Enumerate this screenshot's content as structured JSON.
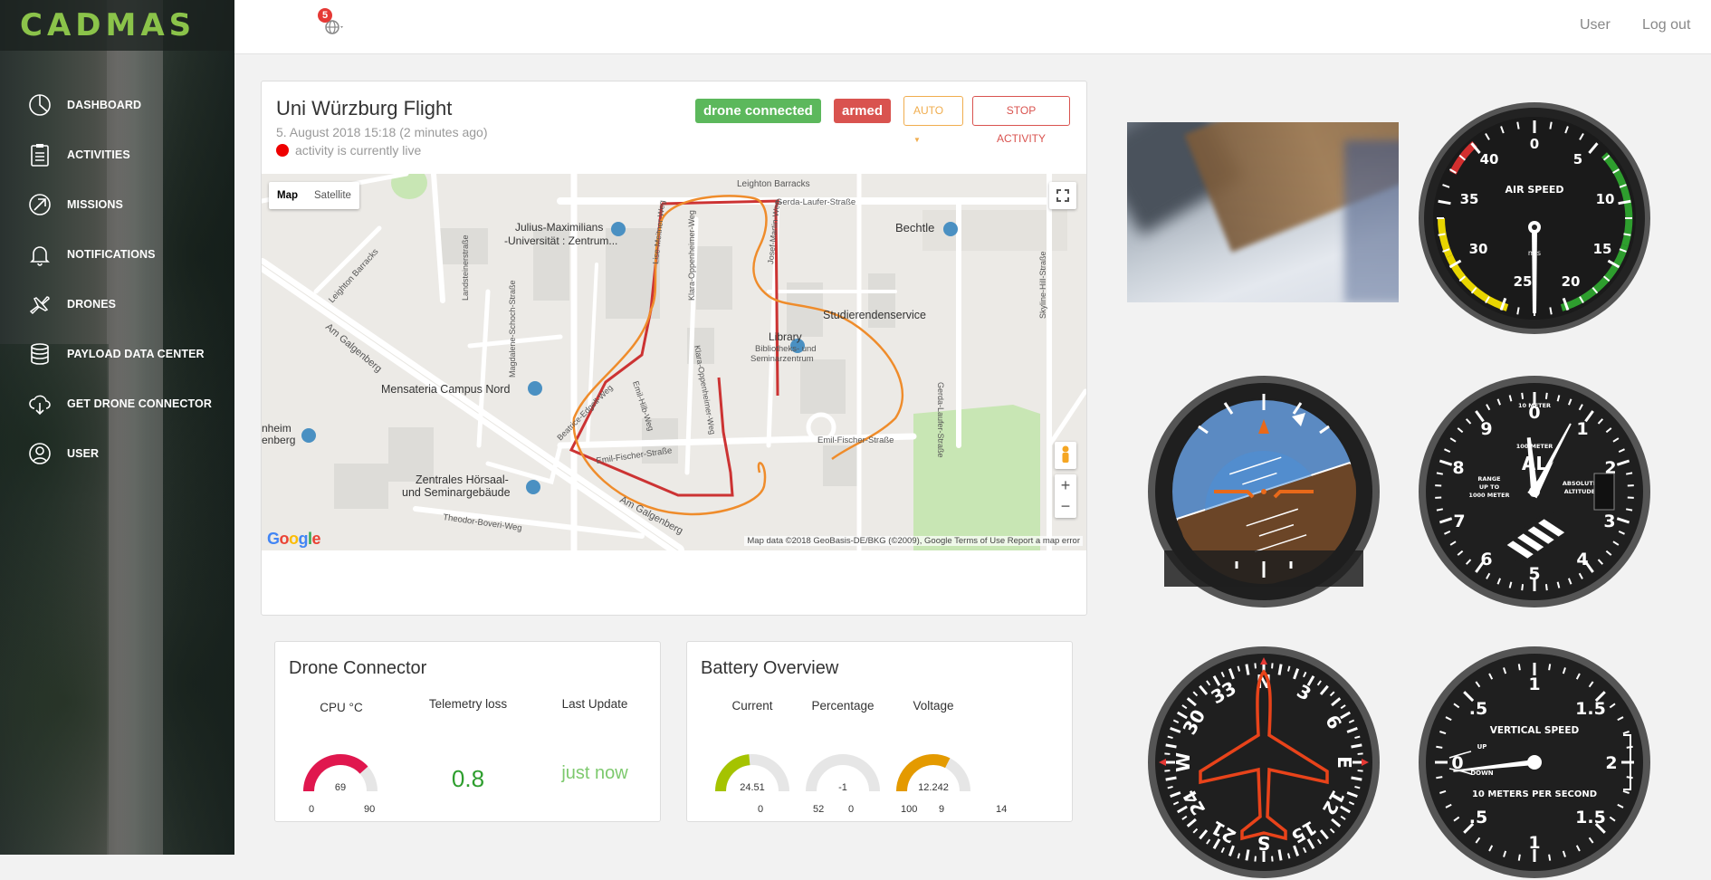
{
  "app": {
    "name": "CADMAS"
  },
  "sidebar": {
    "items": [
      {
        "label": "DASHBOARD"
      },
      {
        "label": "ACTIVITIES"
      },
      {
        "label": "MISSIONS"
      },
      {
        "label": "NOTIFICATIONS"
      },
      {
        "label": "DRONES"
      },
      {
        "label": "PAYLOAD DATA CENTER"
      },
      {
        "label": "GET DRONE CONNECTOR"
      },
      {
        "label": "USER"
      }
    ]
  },
  "topbar": {
    "notification_count": "5",
    "user_label": "User",
    "logout_label": "Log out"
  },
  "flight": {
    "title": "Uni Würzburg Flight",
    "date": "5. August 2018 15:18 (2 minutes ago)",
    "live_text": "activity is currently live",
    "status_connected": "drone connected",
    "status_armed": "armed",
    "mode_label": "AUTO",
    "stop_label": "STOP ACTIVITY",
    "colors": {
      "connected": "#5cb85c",
      "armed": "#d9534f",
      "auto": "#f0ad4e",
      "stop": "#d9534f"
    }
  },
  "map": {
    "type_map": "Map",
    "type_satellite": "Satellite",
    "labels": {
      "leighton_barracks_top": "Leighton Barracks",
      "gerda_laufer_1": "Gerda-Laufer-Straße",
      "bechtle": "Bechtle",
      "skyline": "Skyline-Hill-Straße",
      "julius_1": "Julius-Maximilians",
      "julius_2": "-Universität : Zentrum...",
      "landsteiner": "Landsteinerstraße",
      "leighton_barracks_left": "Leighton Barracks",
      "magdalene": "Magdalene-Schoch-Straße",
      "studierenden": "Studierendenservice",
      "library_1": "Library",
      "library_2": "Bibliotheks- und",
      "library_3": "Seminarzentrum",
      "gerda_laufer_2": "Gerda-Laufer-Straße",
      "am_galgenberg_1": "Am Galgenberg",
      "mensateria": "Mensateria Campus Nord",
      "heim_1": "nheim",
      "heim_2": "enberg",
      "beatrice": "Beatrice-Edgell-Weg",
      "emil_hilb": "Emil-Hilb-Weg",
      "klara": "Klara-Oppenheimer-Weg",
      "klara_2": "Klara-Oppenheimer-Weg",
      "emil_fischer_1": "Emil-Fischer-Straße",
      "emil_fischer_2": "Emil-Fischer-Straße",
      "zentrales_1": "Zentrales Hörsaal-",
      "zentrales_2": "und Seminargebäude",
      "am_galgenberg_2": "Am Galgenberg",
      "theodor": "Theodor-Boveri-Weg",
      "lise": "Lise-Meitner-Weg",
      "josef": "Josef-Martin-Weg"
    },
    "google": "Google",
    "footer": "Map data ©2018 GeoBasis-DE/BKG (©2009), Google   Terms of Use   Report a map error",
    "colors": {
      "planned_path": "#cc3333",
      "flown_path": "#ef8c2b"
    }
  },
  "drone_connector": {
    "title": "Drone Connector",
    "cpu_label": "CPU °C",
    "cpu_value": 69,
    "cpu_min": 0,
    "cpu_max": 90,
    "cpu_color": "#e0174e",
    "telemetry_label": "Telemetry loss",
    "telemetry_value": "0.8",
    "update_label": "Last Update",
    "update_value": "just now"
  },
  "battery": {
    "title": "Battery Overview",
    "gauges": [
      {
        "label": "Current",
        "value": 24.51,
        "min": 0,
        "max": 52,
        "color": "#a5c300"
      },
      {
        "label": "Percentage",
        "value": -1,
        "min": 0,
        "max": 100,
        "color": "#999999"
      },
      {
        "label": "Voltage",
        "value": 12.242,
        "min": 9,
        "max": 14,
        "color": "#e49a00"
      }
    ]
  },
  "instruments": {
    "airspeed": {
      "title": "AIR SPEED",
      "unit": "mls",
      "ticks": [
        "0",
        "5",
        "10",
        "15",
        "20",
        "25",
        "30",
        "35",
        "40"
      ],
      "value": 0
    },
    "altimeter": {
      "title_top": "10 METER",
      "title_mid": "100 METER",
      "left_1": "RANGE",
      "left_2": "UP TO",
      "left_3": "1000 METER",
      "right_1": "ABSOLUTE",
      "right_2": "ALTITUDE",
      "ticks": [
        "0",
        "1",
        "2",
        "3",
        "4",
        "5",
        "6",
        "7",
        "8",
        "9"
      ]
    },
    "heading": {
      "ticks": [
        "N",
        "3",
        "6",
        "E",
        "12",
        "15",
        "S",
        "21",
        "24",
        "W",
        "30",
        "33"
      ]
    },
    "vario": {
      "title": "VERTICAL SPEED",
      "subtitle": "10 METERS PER SECOND",
      "up": "UP",
      "down": "DOWN",
      "ticks": [
        "1",
        "1.5",
        "2",
        "1.5",
        "1",
        ".5",
        "0",
        ".5"
      ]
    }
  }
}
